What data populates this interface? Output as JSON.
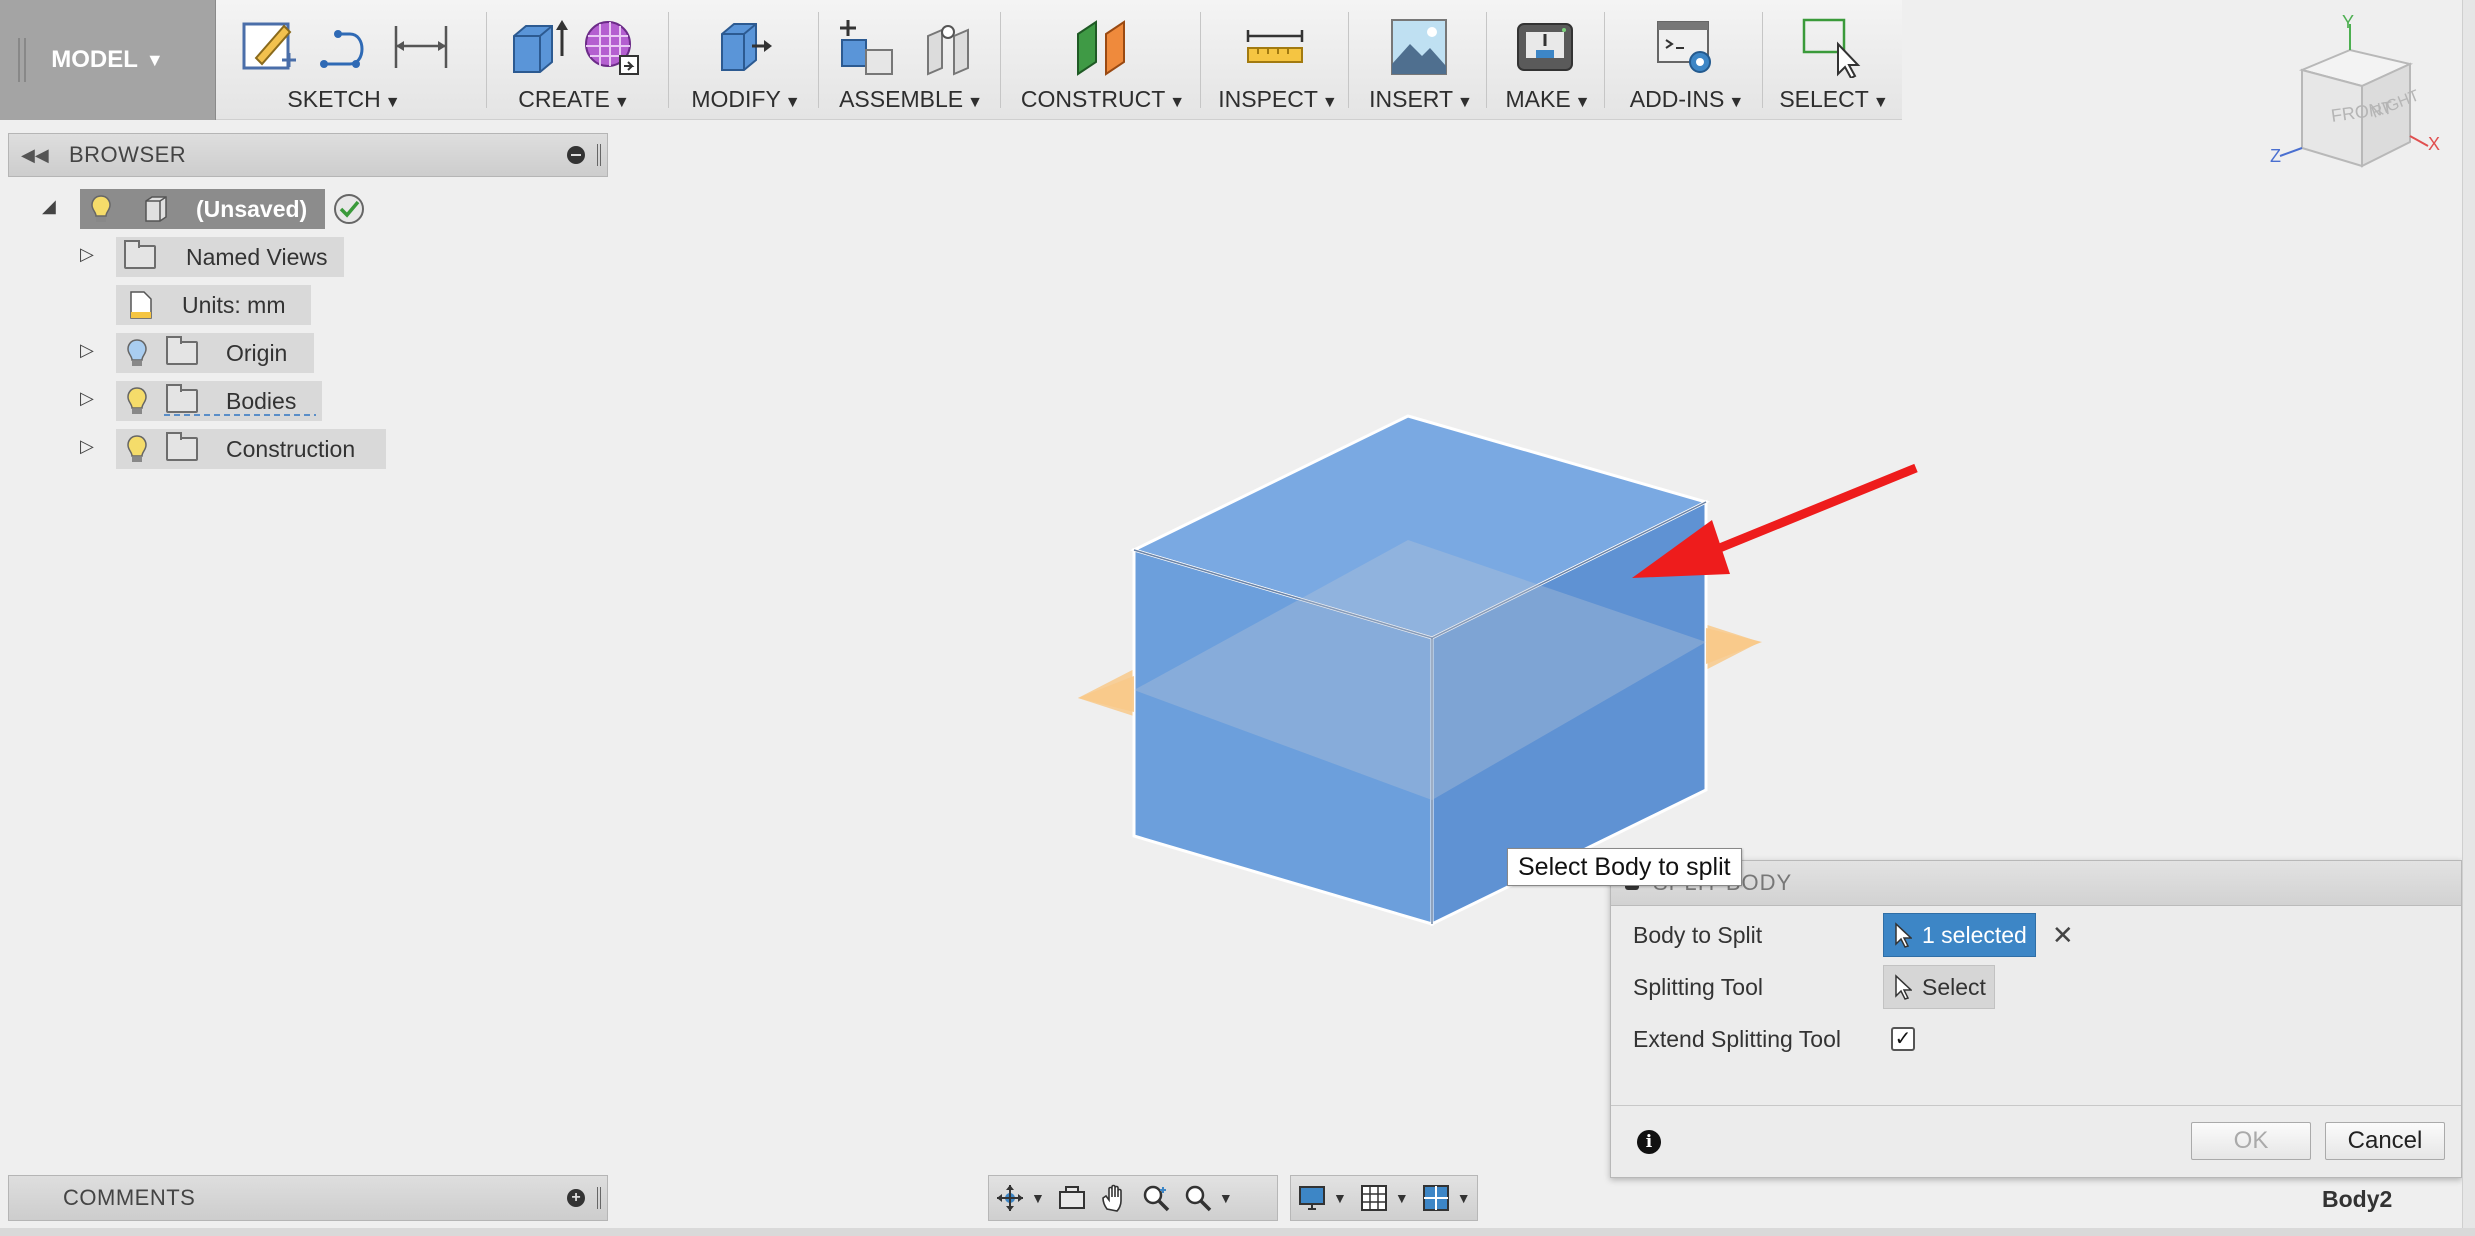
{
  "toolbar": {
    "model_label": "MODEL",
    "groups": [
      {
        "label": "SKETCH"
      },
      {
        "label": "CREATE"
      },
      {
        "label": "MODIFY"
      },
      {
        "label": "ASSEMBLE"
      },
      {
        "label": "CONSTRUCT"
      },
      {
        "label": "INSPECT"
      },
      {
        "label": "INSERT"
      },
      {
        "label": "MAKE"
      },
      {
        "label": "ADD-INS"
      },
      {
        "label": "SELECT"
      }
    ]
  },
  "browser": {
    "title": "BROWSER",
    "root_label": "(Unsaved)",
    "items": [
      {
        "label": "Named Views"
      },
      {
        "label": "Units: mm"
      },
      {
        "label": "Origin"
      },
      {
        "label": "Bodies"
      },
      {
        "label": "Construction"
      }
    ]
  },
  "viewcube": {
    "front": "FRONT",
    "right": "RIGHT",
    "x": "X",
    "y": "Y",
    "z": "Z"
  },
  "tooltip": "Select Body to split",
  "dialog": {
    "title": "SPLIT BODY",
    "rows": [
      {
        "label": "Body to Split",
        "value": "1 selected"
      },
      {
        "label": "Splitting Tool",
        "value": "Select"
      },
      {
        "label": "Extend Splitting Tool",
        "checked": "✓"
      }
    ],
    "info": "i",
    "ok": "OK",
    "cancel": "Cancel"
  },
  "comments": {
    "title": "COMMENTS"
  },
  "status": {
    "body_name": "Body2"
  },
  "colors": {
    "body_blue": "#6a9edb",
    "plane_orange": "#f8c98a",
    "arrow_red": "#ee1c1c",
    "select_blue": "#3d86c6"
  }
}
